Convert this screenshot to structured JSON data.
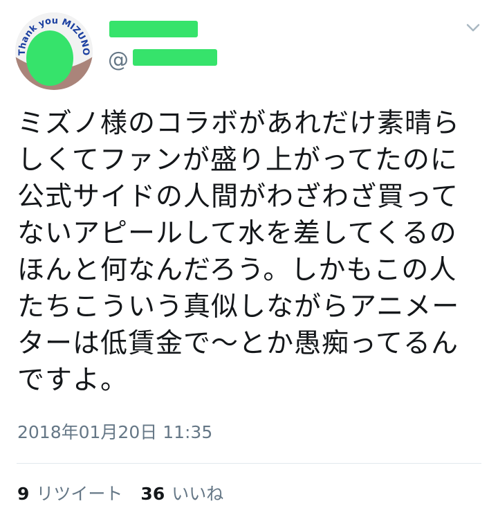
{
  "tweet": {
    "avatar_text": "Thank you MIZUNO",
    "handle_prefix": "@",
    "text": "ミズノ様のコラボがあれだけ素晴らしくてファンが盛り上がってたのに公式サイドの人間がわざわざ買ってないアピールして水を差してくるのほんと何なんだろう。しかもこの人たちこういう真似しながらアニメーターは低賃金で〜とか愚痴ってるんですよ。",
    "timestamp": "2018年01月20日 11:35"
  },
  "stats": {
    "retweets_count": "9",
    "retweets_label": "リツイート",
    "likes_count": "36",
    "likes_label": "いいね"
  },
  "colors": {
    "redaction": "#36e36b",
    "muted_text": "#657786",
    "main_text": "#14171a"
  },
  "icons": {
    "menu": "chevron-down-icon"
  }
}
